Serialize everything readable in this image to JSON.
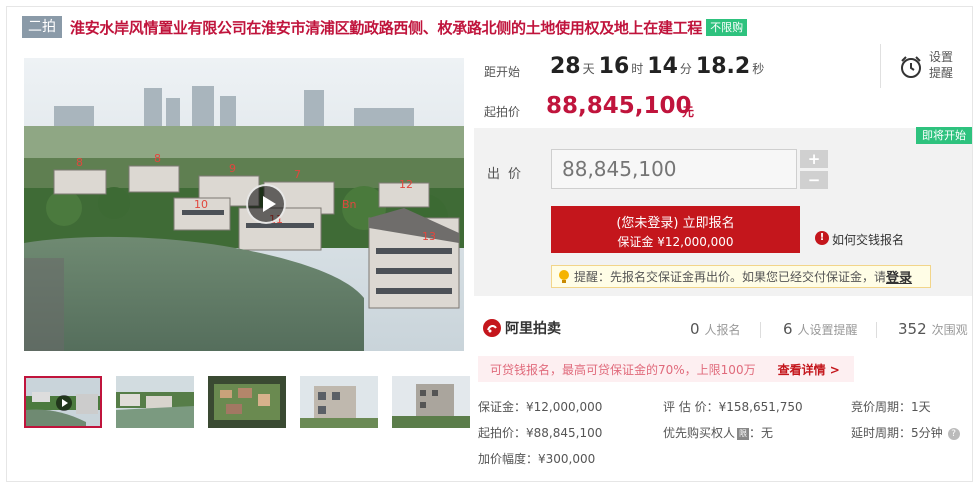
{
  "header": {
    "round_badge": "二拍",
    "title": "淮安水岸风情置业有限公司在淮安市清浦区勤政路西侧、枚承路北侧的土地使用权及地上在建工程",
    "unlimited_tag": "不限购"
  },
  "photo": {
    "building_labels": [
      "8",
      "8",
      "9",
      "7",
      "10",
      "11",
      "12",
      "13",
      "Bn"
    ]
  },
  "countdown": {
    "label": "距开始",
    "days": "28",
    "days_unit": "天",
    "hours": "16",
    "hours_unit": "时",
    "minutes": "14",
    "minutes_unit": "分",
    "seconds": "18.2",
    "seconds_unit": "秒"
  },
  "start_price": {
    "label": "起拍价",
    "value": "88,845,100",
    "unit": "元"
  },
  "reminder": {
    "line1": "设置",
    "line2": "提醒",
    "icon": "alarm-clock-icon"
  },
  "bid": {
    "status_badge": "即将开始",
    "label": "出价",
    "input_placeholder": "88,845,100",
    "plus": "+",
    "minus": "−",
    "signup_main": "(您未登录) 立即报名",
    "signup_sub": "保证金 ¥12,000,000",
    "deposit_info_icon": "!",
    "deposit_link": "如何交钱报名",
    "tip_prefix": "提醒：先报名交保证金再出价。如果您已经交付保证金，请",
    "tip_login": "登录"
  },
  "stats": {
    "brand": "阿里拍卖",
    "signups_count": "0",
    "signups_label": "人报名",
    "reminders_count": "6",
    "reminders_label": "人设置提醒",
    "views_count": "352",
    "views_label": "次围观"
  },
  "promo": {
    "text": "可贷钱报名，最高可贷保证金的70%，上限100万",
    "link": "查看详情 >"
  },
  "info": {
    "deposit": "保证金：¥12,000,000",
    "appraisal": "评 估 价：¥158,651,750",
    "bid_period": "竞价周期：1天",
    "start_price": "起拍价：¥88,845,100",
    "priority_buyer_label": "优先购买权人",
    "priority_buyer_badge": "限",
    "priority_buyer_value": "：无",
    "delay_period": "延时周期：5分钟",
    "help_icon": "?",
    "increment": "加价幅度：¥300,000"
  },
  "colors": {
    "accent_red": "#c0143c",
    "button_red": "#c4161c",
    "badge_green": "#2ec27e",
    "round_badge_gray": "#8a9aa8"
  }
}
